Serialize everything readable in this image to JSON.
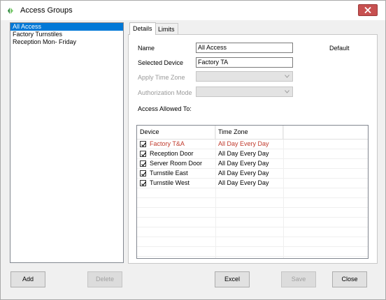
{
  "window": {
    "title": "Access Groups"
  },
  "groups": [
    {
      "label": "All Access",
      "selected": true
    },
    {
      "label": "Factory Turnstiles",
      "selected": false
    },
    {
      "label": "Reception Mon- Friday",
      "selected": false
    }
  ],
  "tabs": [
    {
      "label": "Details",
      "active": true
    },
    {
      "label": "Limits",
      "active": false
    }
  ],
  "details": {
    "name_label": "Name",
    "name_value": "All Access",
    "default_label": "Default",
    "device_label": "Selected Device",
    "device_value": "Factory TA",
    "timezone_label": "Apply Time Zone",
    "auth_label": "Authorization Mode",
    "access_allowed_label": "Access Allowed To:"
  },
  "grid": {
    "headers": {
      "device": "Device",
      "timezone": "Time Zone"
    },
    "rows": [
      {
        "device": "Factory T&A",
        "timezone": "All Day Every Day",
        "checked": true,
        "highlight": true
      },
      {
        "device": "Reception Door",
        "timezone": "All Day Every Day",
        "checked": true,
        "highlight": false
      },
      {
        "device": "Server Room Door",
        "timezone": "All Day Every Day",
        "checked": true,
        "highlight": false
      },
      {
        "device": "Turnstile East",
        "timezone": "All Day Every Day",
        "checked": true,
        "highlight": false
      },
      {
        "device": "Turnstile West",
        "timezone": "All Day Every Day",
        "checked": true,
        "highlight": false
      }
    ]
  },
  "buttons": {
    "add": "Add",
    "delete": "Delete",
    "excel": "Excel",
    "save": "Save",
    "close": "Close"
  },
  "colors": {
    "selection": "#0078d7",
    "highlight_text": "#c0392b",
    "close_button": "#c75050"
  }
}
